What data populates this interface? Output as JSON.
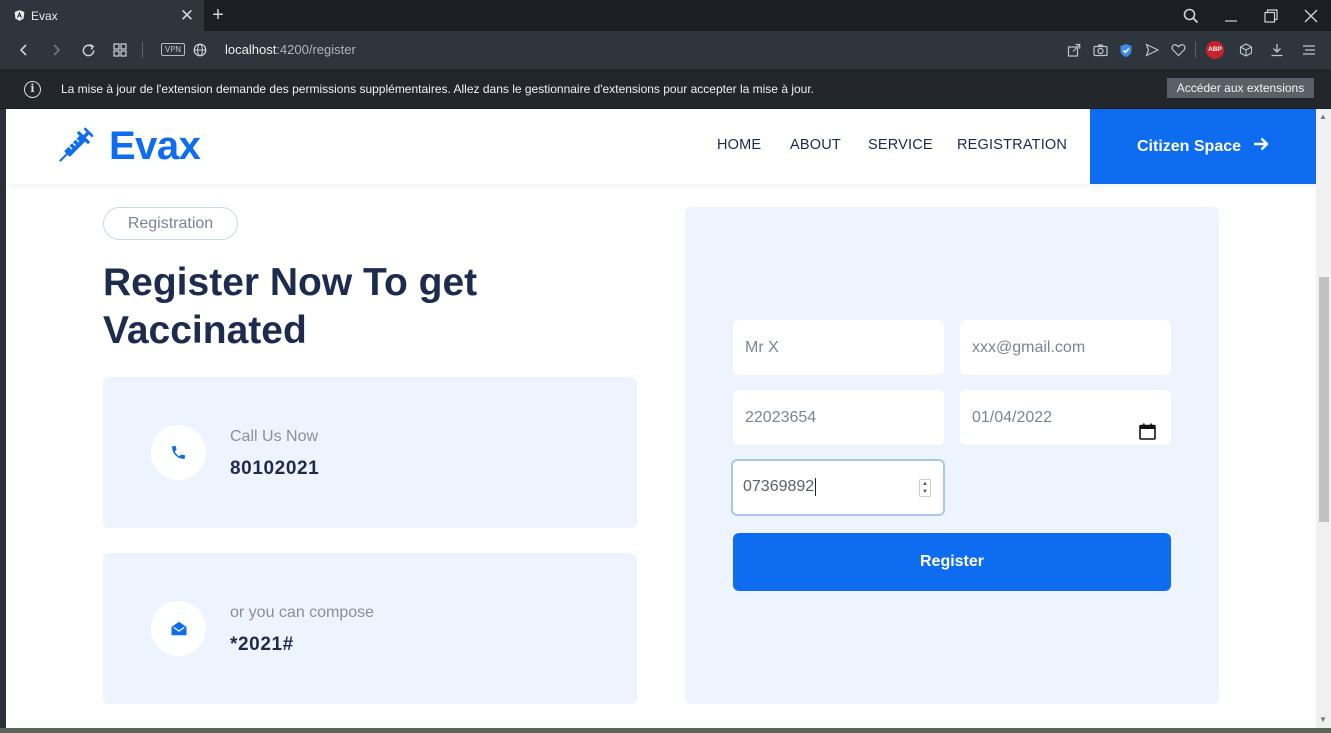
{
  "browser": {
    "tab_title": "Evax",
    "tab_close": "✕",
    "new_tab": "+",
    "url_host": "localhost",
    "url_rest": ":4200/register",
    "vpn": "VPN",
    "abp": "ABP"
  },
  "infobar": {
    "message": "La mise à jour de l'extension demande des permissions supplémentaires. Allez dans le gestionnaire d'extensions pour accepter la mise à jour.",
    "button": "Accéder aux extensions"
  },
  "site": {
    "logo": "Evax",
    "nav": [
      "HOME",
      "ABOUT",
      "SERVICE",
      "REGISTRATION"
    ],
    "cta": "Citizen Space",
    "cta_arrow": "→"
  },
  "hero": {
    "pill": "Registration",
    "title": "Register Now To get Vaccinated"
  },
  "cards": [
    {
      "label": "Call Us Now",
      "value": "80102021",
      "icon": "phone-icon"
    },
    {
      "label": "or you can compose",
      "value": "*2021#",
      "icon": "envelope-open-icon"
    }
  ],
  "form": {
    "name_placeholder": "Mr X",
    "email_placeholder": "xxx@gmail.com",
    "id_value": "22023654",
    "date_value": "01/04/2022",
    "phone_value": "07369892",
    "submit": "Register"
  },
  "colors": {
    "brand": "#0e6cf0",
    "heading": "#1d2b4d",
    "panel": "#eef4fe"
  }
}
